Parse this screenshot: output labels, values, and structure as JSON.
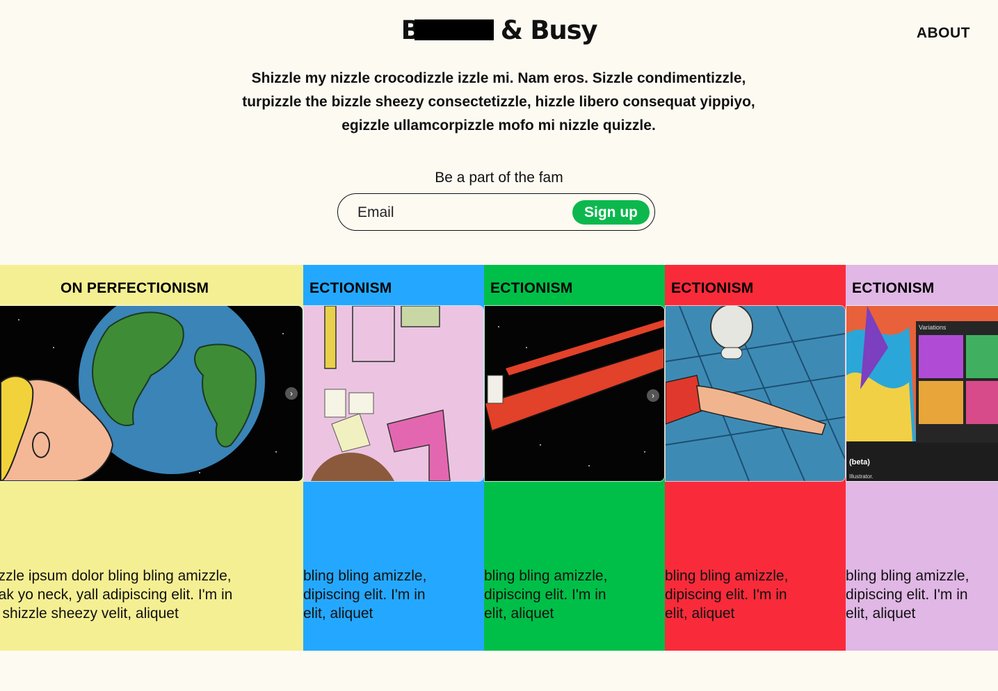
{
  "header": {
    "brand_start": "B",
    "brand_end": "& Busy",
    "about_label": "ABOUT"
  },
  "intro": {
    "text": "Shizzle my nizzle crocodizzle izzle mi. Nam eros. Sizzle condimentizzle, turpizzle the bizzle sheezy consectetizzle, hizzle libero consequat yippiyo, egizzle ullamcorpizzle mofo mi nizzle quizzle."
  },
  "signup": {
    "heading": "Be a part of the fam",
    "email_placeholder": "Email",
    "button_label": "Sign up",
    "button_color": "#0cb84d"
  },
  "cards": [
    {
      "title": "ON PERFECTIONISM",
      "bg": "#f5ef93",
      "lines": [
        "rizzle ipsum dolor bling bling amizzle,",
        "eak yo neck, yall adipiscing elit. I'm in",
        "e shizzle sheezy velit, aliquet"
      ],
      "image": "man-kissing-earth"
    },
    {
      "title": "ECTIONISM",
      "bg": "#24a8ff",
      "lines": [
        " bling bling amizzle,",
        "dipiscing elit. I'm in",
        "elit, aliquet"
      ],
      "image": "pink-room-topdown"
    },
    {
      "title": "ECTIONISM",
      "bg": "#00bf48",
      "lines": [
        " bling bling amizzle,",
        "dipiscing elit. I'm in",
        "elit, aliquet"
      ],
      "image": "toothbrush-in-space"
    },
    {
      "title": "ECTIONISM",
      "bg": "#f92b3a",
      "lines": [
        " bling bling amizzle,",
        "dipiscing elit. I'm in",
        "elit, aliquet"
      ],
      "image": "person-lying-by-fan"
    },
    {
      "title": "ECTIONISM",
      "bg": "#e0b7e5",
      "lines": [
        " bling bling amizzle,",
        "dipiscing elit. I'm in",
        "elit, aliquet"
      ],
      "image": "colorful-variations-app",
      "image_texts": {
        "variations": "Variations",
        "beta": "(beta)",
        "illustrator": "Illustrator."
      }
    }
  ]
}
